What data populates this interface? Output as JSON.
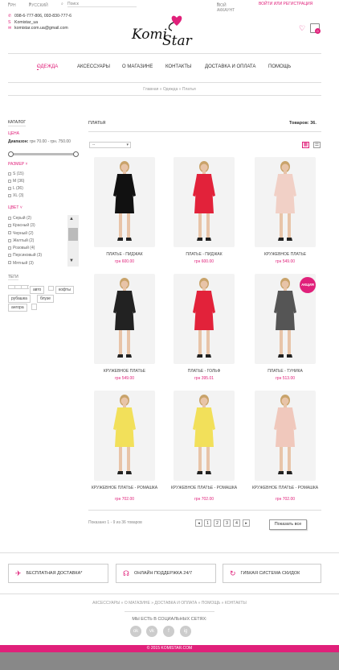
{
  "topbar": {
    "currency": "ГРН",
    "language": "РУССКИЙ",
    "search_placeholder": "Поиск",
    "account": "МОЙ АККАУНТ",
    "login": "ВОЙТИ ИЛИ РЕГИСТРАЦИЯ"
  },
  "contacts": {
    "phones": "098-6-777-806, 093-830-777-6",
    "skype": "Komistar_ua",
    "email": "komistar.com.ua@gmail.com"
  },
  "logo": {
    "text1": "Komi",
    "text2": "Star"
  },
  "cart": {
    "count": "0"
  },
  "nav": {
    "items": [
      "ОДЕЖДА",
      "АКСЕССУАРЫ",
      "О МАГАЗИНЕ",
      "КОНТАКТЫ",
      "ДОСТАВКА И ОПЛАТА",
      "ПОМОЩЬ"
    ]
  },
  "breadcrumb": "Главная » Одежда » Платья",
  "sidebar": {
    "catalog": "КАТАЛОГ",
    "price_title": "ЦЕНА",
    "range_label": "Диапазон:",
    "range_value": "грн 70.00 - грн. 750.00",
    "size_title": "РАЗМЕР",
    "sizes": [
      "S (15)",
      "M (36)",
      "L (36)",
      "XL (3)"
    ],
    "color_title": "ЦВЕТ",
    "colors": [
      "Серый (2)",
      "Красный (3)",
      "Черный (2)",
      "Желтый (2)",
      "Розовый (4)",
      "Персиковый (3)",
      "Мятный (3)"
    ],
    "tags_title": "ТЕГИ",
    "tags": [
      "авто",
      "кофты",
      "рубашка",
      "блузе",
      "ангора"
    ]
  },
  "main": {
    "title": "ПЛАТЬЯ",
    "count_label": "Товаров:",
    "count_value": "36",
    "sort_value": "--"
  },
  "products": [
    {
      "name": "ПЛАТЬЕ - ПИДЖАК",
      "price": "грн 600.00",
      "dress": "#111",
      "skin": "#e8c4a8",
      "sale": false
    },
    {
      "name": "ПЛАТЬЕ - ПИДЖАК",
      "price": "грн 600.00",
      "dress": "#e2223a",
      "skin": "#e8c4a8",
      "sale": false
    },
    {
      "name": "КРУЖЕВНОЕ ПЛАТЬЕ",
      "price": "грн 549.00",
      "dress": "#f1d0c6",
      "skin": "#e8c4a8",
      "sale": false
    },
    {
      "name": "КРУЖЕВНОЕ ПЛАТЬЕ",
      "price": "грн 549.00",
      "dress": "#222",
      "skin": "#e8c4a8",
      "sale": false
    },
    {
      "name": "ПЛАТЬЕ - ГОЛЬФ",
      "price": "грн 395.01",
      "dress": "#e2223a",
      "skin": "#e8c4a8",
      "sale": false
    },
    {
      "name": "ПЛАТЬЕ - ТУНИКА",
      "price": "грн 513.00",
      "dress": "#555",
      "skin": "#e8c4a8",
      "sale": true,
      "sale_label": "АКЦИЯ"
    },
    {
      "name": "КРУЖЕВНОЕ ПЛАТЬЕ - РОМАШКА",
      "price": "грн 702.00",
      "dress": "#f2e05a",
      "skin": "#e8c4a8",
      "sale": false
    },
    {
      "name": "КРУЖЕВНОЕ ПЛАТЬЕ - РОМАШКА",
      "price": "грн 702.00",
      "dress": "#f2e05a",
      "skin": "#e8c4a8",
      "sale": false
    },
    {
      "name": "КРУЖЕВНОЕ ПЛАТЬЕ - РОМАШКА",
      "price": "грн 702.00",
      "dress": "#f0c8bc",
      "skin": "#e8c4a8",
      "sale": false
    }
  ],
  "pagination": {
    "info": "Показано 1 - 9 из 36 товаров",
    "pages": [
      "1",
      "2",
      "3",
      "4"
    ],
    "show_all": "Показать все"
  },
  "features": [
    "БЕСПЛАТНАЯ ДОСТАВКА*",
    "ОНЛАЙН ПОДДЕРЖКА 24/7",
    "ГИБКАЯ СИСТЕМА СКИДОК"
  ],
  "footer": {
    "links": "АКСЕССУАРЫ » О МАГАЗИНЕ » ДОСТАВКА И ОПЛАТА » ПОМОЩЬ » КОНТАКТЫ",
    "social_title": "МЫ ЕСТЬ В СОЦИАЛЬНЫХ СЕТЯХ:",
    "social": [
      "ok",
      "vk",
      "f",
      "ig"
    ],
    "copyright": "© 2015 KOMISTAR.COM"
  },
  "colors": {
    "accent": "#e0207a",
    "footer_bar": "#e0207a"
  }
}
